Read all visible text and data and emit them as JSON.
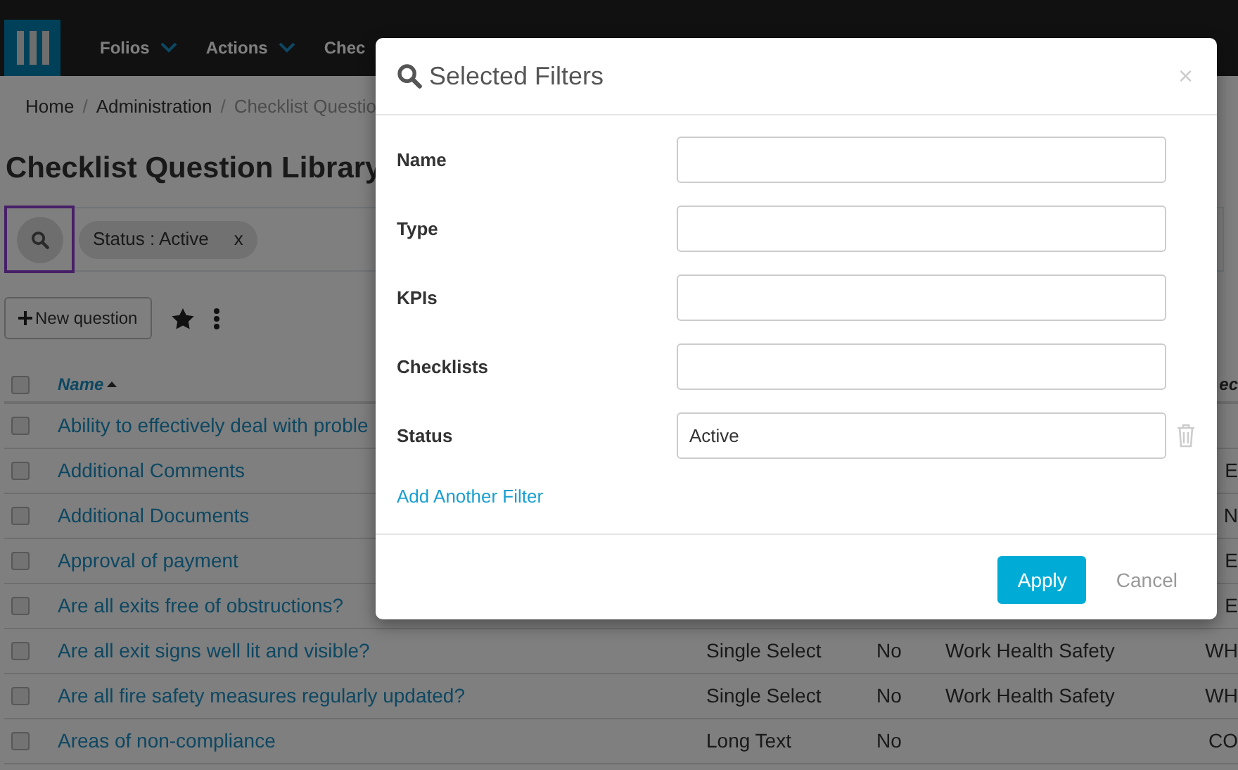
{
  "nav": {
    "items": [
      {
        "label": "Folios",
        "has_menu": true
      },
      {
        "label": "Actions",
        "has_menu": true
      },
      {
        "label": "Chec",
        "has_menu": false
      }
    ]
  },
  "breadcrumb": [
    {
      "label": "Home",
      "separator": "/"
    },
    {
      "label": "Administration",
      "separator": "/"
    },
    {
      "label": "Checklist Questio"
    }
  ],
  "title": "Checklist Question Library",
  "filter_bar": {
    "chips": [
      {
        "label": "Status : Active",
        "remove": "x"
      }
    ]
  },
  "toolbar": {
    "new_button": "New question"
  },
  "table": {
    "header_checked": false,
    "columns": [
      {
        "label": "Name",
        "sorted_ascending": true
      },
      {
        "label": "ec"
      }
    ],
    "rows": [
      {
        "checked": false,
        "name": "Ability to effectively deal with proble"
      },
      {
        "checked": false,
        "name": "Additional Comments",
        "code": "E"
      },
      {
        "checked": false,
        "name": "Additional Documents",
        "code": "N"
      },
      {
        "checked": false,
        "name": "Approval of payment",
        "code": "E"
      },
      {
        "checked": false,
        "name": "Are all exits free of obstructions?",
        "code": "E"
      },
      {
        "checked": false,
        "name": "Are all exit signs well lit and visible?",
        "type": "Single Select",
        "required": "No",
        "category": "Work Health Safety",
        "code": "WH"
      },
      {
        "checked": false,
        "name": "Are all fire safety measures regularly updated?",
        "type": "Single Select",
        "required": "No",
        "category": "Work Health Safety",
        "code": "WH"
      },
      {
        "checked": false,
        "name": "Areas of non-compliance",
        "type": "Long Text",
        "required": "No",
        "code": "CO"
      }
    ]
  },
  "modal": {
    "title": "Selected Filters",
    "close": "×",
    "fields": [
      {
        "label": "Name",
        "removable": false
      },
      {
        "label": "Type",
        "removable": false
      },
      {
        "label": "KPIs",
        "removable": false
      },
      {
        "label": "Checklists",
        "removable": false
      },
      {
        "label": "Status",
        "value": "Active",
        "removable": true
      }
    ],
    "add_link": "Add Another Filter",
    "apply": "Apply",
    "cancel": "Cancel"
  }
}
